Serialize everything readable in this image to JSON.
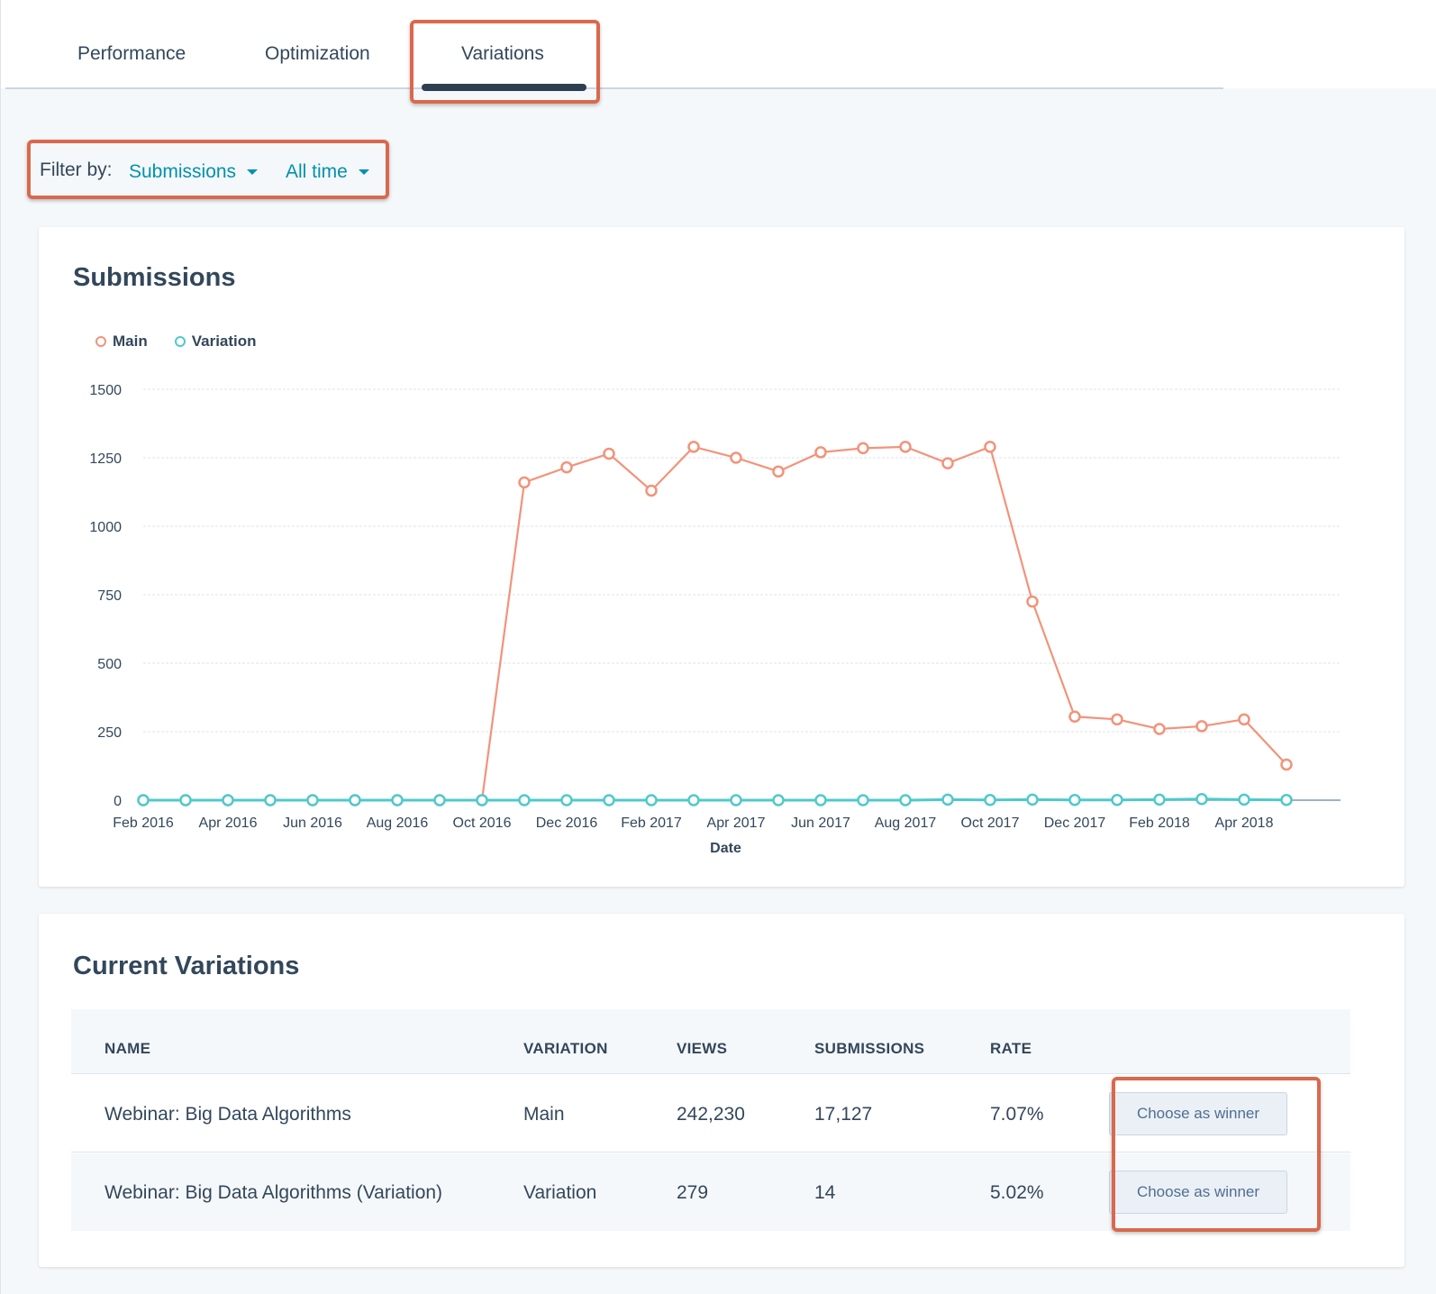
{
  "tabs": [
    {
      "label": "Performance",
      "active": false
    },
    {
      "label": "Optimization",
      "active": false
    },
    {
      "label": "Variations",
      "active": true
    }
  ],
  "filter": {
    "label": "Filter by:",
    "metric": "Submissions",
    "range": "All time"
  },
  "chart_section": {
    "title": "Submissions"
  },
  "chart_data": {
    "type": "line",
    "title": "Submissions",
    "xlabel": "Date",
    "ylabel": "",
    "ylim": [
      0,
      1500
    ],
    "yticks": [
      "0",
      "250",
      "500",
      "750",
      "1000",
      "1250",
      "1500"
    ],
    "xtick_labels": [
      "Feb 2016",
      "Apr 2016",
      "Jun 2016",
      "Aug 2016",
      "Oct 2016",
      "Dec 2016",
      "Feb 2017",
      "Apr 2017",
      "Jun 2017",
      "Aug 2017",
      "Oct 2017",
      "Dec 2017",
      "Feb 2018",
      "Apr 2018"
    ],
    "x": [
      "Feb 2016",
      "Mar 2016",
      "Apr 2016",
      "May 2016",
      "Jun 2016",
      "Jul 2016",
      "Aug 2016",
      "Sep 2016",
      "Oct 2016",
      "Nov 2016",
      "Dec 2016",
      "Jan 2017",
      "Feb 2017",
      "Mar 2017",
      "Apr 2017",
      "May 2017",
      "Jun 2017",
      "Jul 2017",
      "Aug 2017",
      "Sep 2017",
      "Oct 2017",
      "Nov 2017",
      "Dec 2017",
      "Jan 2018",
      "Feb 2018",
      "Mar 2018",
      "Apr 2018",
      "May 2018"
    ],
    "series": [
      {
        "name": "Main",
        "color": "#f2937a",
        "values": [
          0,
          0,
          0,
          0,
          0,
          0,
          0,
          0,
          0,
          1160,
          1215,
          1265,
          1130,
          1290,
          1250,
          1200,
          1270,
          1285,
          1290,
          1230,
          1290,
          725,
          305,
          295,
          260,
          270,
          295,
          130
        ]
      },
      {
        "name": "Variation",
        "color": "#4fc9cc",
        "values": [
          0,
          0,
          0,
          0,
          0,
          0,
          0,
          0,
          0,
          0,
          0,
          0,
          0,
          0,
          0,
          0,
          0,
          0,
          0,
          2,
          1,
          2,
          1,
          1,
          2,
          4,
          2,
          1
        ]
      }
    ],
    "grid": true,
    "legend_position": "top-left"
  },
  "variations_table": {
    "title": "Current Variations",
    "columns": [
      "NAME",
      "VARIATION",
      "VIEWS",
      "SUBMISSIONS",
      "RATE"
    ],
    "rows": [
      {
        "name": "Webinar: Big Data Algorithms",
        "variation": "Main",
        "views": "242,230",
        "submissions": "17,127",
        "rate": "7.07%",
        "action": "Choose as winner"
      },
      {
        "name": "Webinar: Big Data Algorithms (Variation)",
        "variation": "Variation",
        "views": "279",
        "submissions": "14",
        "rate": "5.02%",
        "action": "Choose as winner"
      }
    ]
  },
  "colors": {
    "accent": "#0091ae",
    "highlight": "#d9694e",
    "main_series": "#f2937a",
    "variation_series": "#4fc9cc"
  }
}
